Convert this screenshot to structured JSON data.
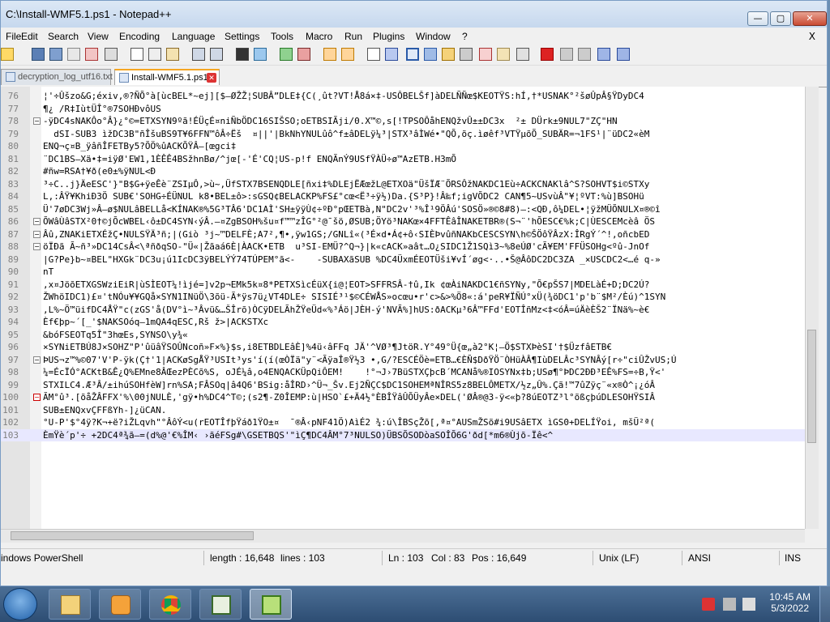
{
  "window": {
    "title": "C:\\Install-WMF5.1.ps1 - Notepad++",
    "min": "—",
    "max": "▢",
    "close": "✕"
  },
  "menu": [
    "File",
    "Edit",
    "Search",
    "View",
    "Encoding",
    "Language",
    "Settings",
    "Tools",
    "Macro",
    "Run",
    "Plugins",
    "Window",
    "?"
  ],
  "menu_close": "X",
  "tabs": [
    {
      "label": "decryption_log_utf16.txt",
      "active": false
    },
    {
      "label": "Install-WMF5.1.ps1",
      "active": true
    }
  ],
  "editor": {
    "lines": [
      {
        "n": "76",
        "t": "¦'÷Ûšzo&G;éxiv,®?ÑÕ°à[ùcBEL*~ej][$—ØŽŽ¦SUBÂ”DLE‡{C(¸ût?VT!Å8á×‡-USÔBELŠf]àDELÑÑœ$KEOTŸS:hÍ,†*USNAK°²šøÛpÂ§ŸDyDC4"
      },
      {
        "n": "77",
        "t": "¶¿ /R‡IùtÜÎ°®7SOHÐvôUS"
      },
      {
        "n": "78",
        "t": "-ÿDC4sNAKÔo°Â}¿°©=ETXSYN9ºã!ÉÜçÉ¤niÑbÖDC16SIŠSO;oETBSIÃji/0.X™©,s[!TPSOÔåhENQžvÛ±±DC3x  ²± DÜrk±9NUL7\"ZÇ\"HN"
      },
      {
        "n": "79",
        "t": "  dSI-SUB3 ìžDC3B\"ñÎšuBS9T¥6FFN™ôÂ÷Ëš  ¤||'|BkNhYNULûô^f±âDELÿ¼³|STX³âÌWé•\"QÕ,õç.ìøêf³VTŸµõÕ_SUBÄR=¬1FS¹|¨üDC2«èM"
      },
      {
        "n": "80",
        "t": "ENQ¬ç¤B_ÿâñÎFETBy5?ÕÖ%ûACKÕŸÂ–[œgci‡"
      },
      {
        "n": "81",
        "t": "¨DC1BS–Xä•‡=iÿØ'EW1,1ÈÊÊ4BSžhnBø/^jœ[-'É'CQ¦US-p!f ENQÃnÝ9USfŸÀÜ÷ø™AzETB.H3mÕ"
      },
      {
        "n": "82",
        "t": "#ñw=RSA†¥ð(e0±%ÿNUL<Ð"
      },
      {
        "n": "83",
        "t": "³÷C..j}ÄeESC'}\"B$G+ÿeÊè¨ZSIµÔ,>ù~,ÜfSTX7BSENQDLE[ñxi‡%DLEjËÆœžL@ETXOä\"ÜšÏÆ¨ÕRSÔžNAKDC1Eù÷ACKCNAKlâ^S?SOHVT$i©STXy"
      },
      {
        "n": "84",
        "t": "L,:ÂŸ¥KhiÐ3Ö SUB€'SOHG÷ÉÜNUL k8•BEL±ô>:sGSQ¢BELACKP%FS£°cœ<Ë³÷ÿ½)Da.{S³P}!Â‰f;igVÕDC2 CAN¶5~USvùÂ\"¥¦ºVT:%ù]BSOHü"
      },
      {
        "n": "85",
        "t": "Ü'7øDC3Wj»Â—ø$NULâBELLå<KÍNAK®%5G³TÂ6'DC1AÌ'SH±ÿÿÙ¢÷ºÐ°pŒETBà,N\"DC2v'³%Î¹9ÖÂú'SOSÖ»®©8#8)—:<QÐ,ô¼DEL•¦ÿžMÜÕNULX¤®©î"
      },
      {
        "n": "86",
        "t": "ÕWâÙâSTX²0†©jÕcWBEL‹ô±DC4SYN‹ýÂ.—¤ZgBSOH%šu¤f™™zÎG°²@¯šö,ØSUB;ÖYö³NAKœ×4FFTÊâÎNAKETBR®(S¬¨'hÕESC€%k;C|ÙESCEMcèâ ÖS"
      },
      {
        "n": "87",
        "t": "Âû,ZNAKiETXÉžÇ•NULSŸÄ³ñ;|(Giò ³j~™DELFÈ;A7²,¶•,ÿw1GS;/GNLî«(³É×d•Á¢+ô‹SIÈÞvûñNAKbCESCSYN\\h©ŠÖôŸÂzX:ÎRgÝ´^!,oñcbED"
      },
      {
        "n": "88",
        "t": "öÏÐã Ã~ñ³»DC14CsÂ<\\ªñðqSO-\"Ü«|Žãaá6È|ÀACK•ETB  u³SI-EMÜ?^Q¬}|k«cACK»aât…O¿SIDC1Ž1SQì3~%8eÚØ'cÃ¥EM'FFÜSOHg<ºû-JnOf"
      },
      {
        "n": "89",
        "t": "|G?Pe}b~¤BEL\"HXGk¨DC3u¡ú1IcDC3ÿBELÝÝ74TÚPEM°ã<-    -SUBAXãSUB %DC4ÜxmÉEOTÜši¥vÍ´øg<·..•Š@ÂôDC2DC3ZA _×USCDC2<…é q-»"
      },
      {
        "n": "90",
        "t": "nT"
      },
      {
        "n": "91",
        "t": ",x¤JöõETXGSWziEiR|ùSÌEOT¼!ìjé=]v2p¬EMk5k¤8*PETXSìcÉüX{i@¦EOT>SFFRSÂ-†û,Ik ¢œÀiNAKDC1€ñSYNy,\"Õ€pŠS7|MDELàÉ+D;DC2Ú?"
      },
      {
        "n": "92",
        "t": "ŽWhöIDC1)£¤'tNÓu¥¥GQå×SYN1INüÖ\\3õü-Ã*ÿs7ü¿VT4DLE÷ SISIÉ³¹$©CÉWÅS»ocœu•r'c>&>%Ö8«:á'peR¥ÏÑÚ°xÜ(¾öDC1'p'b¨$M²/Èú)^1SYN"
      },
      {
        "n": "93",
        "t": ",L%~Ö™üifDC4ÅŸ\"c(zGS'å(DV°ì~³Âvü&…ŠÎrõ)ÒCÿDELÃhŽŸeÜd«%³Áö|JÈH-ý'NVÃ%]hUS:ðACKµ³6Â™FFd'EOTÎñMz<‡<óÂ=úÄèÈŠ2¨ÏNä%~è€"
      },
      {
        "n": "94",
        "t": "Èf€þp~´[_'$NAKSOóq—1mQA4qESC,Rš ž>|ACKSTXc"
      },
      {
        "n": "95",
        "t": "&bóFSEOTq5Î\"3hœEs,SYNSO\\y¾«"
      },
      {
        "n": "96",
        "t": "×SYNiETBÚ8J×SOHZ\"P'ûüâŸSOÛNcoñ»F×%}$s,i8ETBDLEâÈ]%4ü‹âFFq JÄ'^VØ³¶JtöR.Y°49°Ü{œ„à2°K¦—Ö$STXÞèSI'†$ÜzfâETB€"
      },
      {
        "n": "97",
        "t": "ÞUS¬z™%©07'V'P-ÿk(Ç†'1|ACKøSgÅŸ³USIt³ys'í(í(œÒÏä\"y¨<ÃÿaÎ®Ÿ½3 •,G/?ESCÉÖè=ETB…€ÈÑ$DðŸÖ¨ÒHüÀÂ¶IùDELÂc³SYNÂý[r÷\"ciÛŽvUS;Ú"
      },
      {
        "n": "98",
        "t": "¼=ÉcÏÓ°ACKtB&Ê¿Q%EMne8ÂŒezPÈCõ%S, oJÉ¼â,o4ENQACKÜpQiÔEM!    !°¬J›7BüSTXÇþcB´MCANå%®IOSYNx‡b;USø¶°ÞDC2ÐÐ³EÊ%FS=÷B,Ÿ<'"
      },
      {
        "n": "99",
        "t": "STXILC4.Æ³Â/±ihúSOHfèW]rn%SA;FÂSOq|â4Q6'BSig:åÎRD›^Ü¬_Šv.Ej2ÑÇC$DC1SOHEMªNÎRS5z8BELÔMETX/½z„Û%.Çã!™7ûZÿç¨«x®Ò^¡¿óÂ"
      },
      {
        "n": "100",
        "t": "ÃM°û³.[õåŽÂFFX'%\\00jNULÈ,'gÿ•h%DC4^T©;(s2¶-Z0ÎEMP:ù|HSO`£+Ä4½°ÈBÎŸâÛÕÜyÂe×DEL('ØÂ®@3-ÿ<«þ?8úEOTZ³l°õßçþúDLESOHŸSIÂ"
      },
      {
        "n": "101",
        "t": "SUB±ENQxvÇFFßYh-]¿üCAN."
      },
      {
        "n": "102",
        "t": "°U-P'$°4ÿ?K¬+ë?iŽLqvh\"°ÂôÝ<u(rEOTÎfþŸáð1ŸO±¤  ¯®Â‹pNF41Ö)AìÉ2 ¾:ú\\ÎBSçŽõ[,ª¤°AUSmŽSõ#i9USâETX ìGS0+DELÍŸoi, mšÜ²ª("
      },
      {
        "n": "103",
        "t": "ÈmŸè´p'÷ +2DC4ª¾ã—=(d%@'€%ÎM‹ ›ãéFSg#\\GSETBQS'\"ìÇ¶DC4ÂM°7³NULSO)ÜBSÕSODòaSOÎÕ6G'ðd[*m6®Ùjõ-Ïê<^"
      }
    ]
  },
  "status": {
    "lang": "indows PowerShell",
    "length": "length : 16,648",
    "lines": "lines : 103",
    "ln": "Ln : 103",
    "col": "Col : 83",
    "pos": "Pos : 16,649",
    "eol": "Unix (LF)",
    "enc": "ANSI",
    "mode": "INS"
  },
  "clock": {
    "time": "10:45 AM",
    "date": "5/3/2022"
  },
  "colors": {
    "accent": "#f5a623",
    "title_bg": "#dce8f5",
    "taskbar": "#2d4d73"
  }
}
